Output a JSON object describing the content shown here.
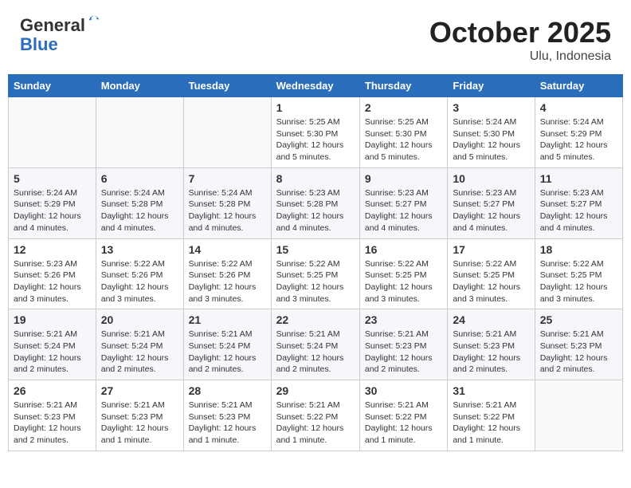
{
  "header": {
    "logo_general": "General",
    "logo_blue": "Blue",
    "month": "October 2025",
    "location": "Ulu, Indonesia"
  },
  "weekdays": [
    "Sunday",
    "Monday",
    "Tuesday",
    "Wednesday",
    "Thursday",
    "Friday",
    "Saturday"
  ],
  "weeks": [
    [
      {
        "day": "",
        "info": ""
      },
      {
        "day": "",
        "info": ""
      },
      {
        "day": "",
        "info": ""
      },
      {
        "day": "1",
        "info": "Sunrise: 5:25 AM\nSunset: 5:30 PM\nDaylight: 12 hours\nand 5 minutes."
      },
      {
        "day": "2",
        "info": "Sunrise: 5:25 AM\nSunset: 5:30 PM\nDaylight: 12 hours\nand 5 minutes."
      },
      {
        "day": "3",
        "info": "Sunrise: 5:24 AM\nSunset: 5:30 PM\nDaylight: 12 hours\nand 5 minutes."
      },
      {
        "day": "4",
        "info": "Sunrise: 5:24 AM\nSunset: 5:29 PM\nDaylight: 12 hours\nand 5 minutes."
      }
    ],
    [
      {
        "day": "5",
        "info": "Sunrise: 5:24 AM\nSunset: 5:29 PM\nDaylight: 12 hours\nand 4 minutes."
      },
      {
        "day": "6",
        "info": "Sunrise: 5:24 AM\nSunset: 5:28 PM\nDaylight: 12 hours\nand 4 minutes."
      },
      {
        "day": "7",
        "info": "Sunrise: 5:24 AM\nSunset: 5:28 PM\nDaylight: 12 hours\nand 4 minutes."
      },
      {
        "day": "8",
        "info": "Sunrise: 5:23 AM\nSunset: 5:28 PM\nDaylight: 12 hours\nand 4 minutes."
      },
      {
        "day": "9",
        "info": "Sunrise: 5:23 AM\nSunset: 5:27 PM\nDaylight: 12 hours\nand 4 minutes."
      },
      {
        "day": "10",
        "info": "Sunrise: 5:23 AM\nSunset: 5:27 PM\nDaylight: 12 hours\nand 4 minutes."
      },
      {
        "day": "11",
        "info": "Sunrise: 5:23 AM\nSunset: 5:27 PM\nDaylight: 12 hours\nand 4 minutes."
      }
    ],
    [
      {
        "day": "12",
        "info": "Sunrise: 5:23 AM\nSunset: 5:26 PM\nDaylight: 12 hours\nand 3 minutes."
      },
      {
        "day": "13",
        "info": "Sunrise: 5:22 AM\nSunset: 5:26 PM\nDaylight: 12 hours\nand 3 minutes."
      },
      {
        "day": "14",
        "info": "Sunrise: 5:22 AM\nSunset: 5:26 PM\nDaylight: 12 hours\nand 3 minutes."
      },
      {
        "day": "15",
        "info": "Sunrise: 5:22 AM\nSunset: 5:25 PM\nDaylight: 12 hours\nand 3 minutes."
      },
      {
        "day": "16",
        "info": "Sunrise: 5:22 AM\nSunset: 5:25 PM\nDaylight: 12 hours\nand 3 minutes."
      },
      {
        "day": "17",
        "info": "Sunrise: 5:22 AM\nSunset: 5:25 PM\nDaylight: 12 hours\nand 3 minutes."
      },
      {
        "day": "18",
        "info": "Sunrise: 5:22 AM\nSunset: 5:25 PM\nDaylight: 12 hours\nand 3 minutes."
      }
    ],
    [
      {
        "day": "19",
        "info": "Sunrise: 5:21 AM\nSunset: 5:24 PM\nDaylight: 12 hours\nand 2 minutes."
      },
      {
        "day": "20",
        "info": "Sunrise: 5:21 AM\nSunset: 5:24 PM\nDaylight: 12 hours\nand 2 minutes."
      },
      {
        "day": "21",
        "info": "Sunrise: 5:21 AM\nSunset: 5:24 PM\nDaylight: 12 hours\nand 2 minutes."
      },
      {
        "day": "22",
        "info": "Sunrise: 5:21 AM\nSunset: 5:24 PM\nDaylight: 12 hours\nand 2 minutes."
      },
      {
        "day": "23",
        "info": "Sunrise: 5:21 AM\nSunset: 5:23 PM\nDaylight: 12 hours\nand 2 minutes."
      },
      {
        "day": "24",
        "info": "Sunrise: 5:21 AM\nSunset: 5:23 PM\nDaylight: 12 hours\nand 2 minutes."
      },
      {
        "day": "25",
        "info": "Sunrise: 5:21 AM\nSunset: 5:23 PM\nDaylight: 12 hours\nand 2 minutes."
      }
    ],
    [
      {
        "day": "26",
        "info": "Sunrise: 5:21 AM\nSunset: 5:23 PM\nDaylight: 12 hours\nand 2 minutes."
      },
      {
        "day": "27",
        "info": "Sunrise: 5:21 AM\nSunset: 5:23 PM\nDaylight: 12 hours\nand 1 minute."
      },
      {
        "day": "28",
        "info": "Sunrise: 5:21 AM\nSunset: 5:23 PM\nDaylight: 12 hours\nand 1 minute."
      },
      {
        "day": "29",
        "info": "Sunrise: 5:21 AM\nSunset: 5:22 PM\nDaylight: 12 hours\nand 1 minute."
      },
      {
        "day": "30",
        "info": "Sunrise: 5:21 AM\nSunset: 5:22 PM\nDaylight: 12 hours\nand 1 minute."
      },
      {
        "day": "31",
        "info": "Sunrise: 5:21 AM\nSunset: 5:22 PM\nDaylight: 12 hours\nand 1 minute."
      },
      {
        "day": "",
        "info": ""
      }
    ]
  ]
}
